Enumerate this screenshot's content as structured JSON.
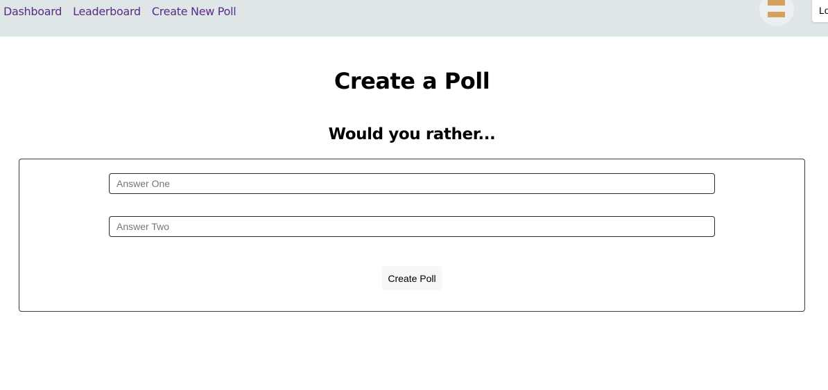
{
  "nav": {
    "links": [
      "Dashboard",
      "Leaderboard",
      "Create New Poll"
    ],
    "logout_label": "Lo",
    "link_color": "#5b2a86",
    "bg_color": "#dfe6e8"
  },
  "avatar": {
    "icon": "avatar-icon",
    "accent_color": "#d6a15f"
  },
  "page": {
    "title": "Create a Poll",
    "subtitle": "Would you rather..."
  },
  "form": {
    "option_one_placeholder": "Answer One",
    "option_two_placeholder": "Answer Two",
    "option_one_value": "",
    "option_two_value": "",
    "submit_label": "Create Poll"
  }
}
